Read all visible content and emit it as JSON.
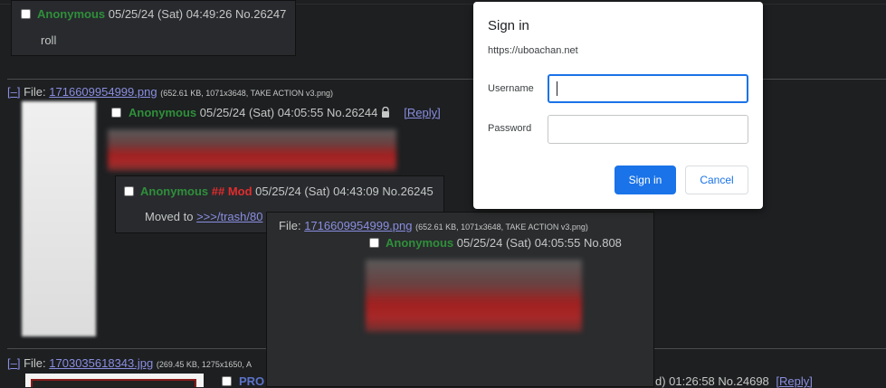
{
  "post_top": {
    "name": "Anonymous",
    "datetime": "05/25/24 (Sat) 04:49:26",
    "number": "No.26247",
    "message": "roll"
  },
  "thread1": {
    "toggle": "[–]",
    "file_label": "File:",
    "file_name": "1716609954999.png",
    "file_info": "(652.61 KB, 1071x3648, TAKE ACTION v3.png)",
    "op_name": "Anonymous",
    "op_datetime": "05/25/24 (Sat) 04:05:55",
    "op_number": "No.26244",
    "lock_icon": "lock-icon",
    "reply_link": "[Reply]",
    "mod_reply": {
      "name": "Anonymous",
      "capcode": "## Mod",
      "datetime": "05/25/24 (Sat) 04:43:09",
      "number": "No.26245",
      "message_prefix": "Moved to ",
      "message_link": ">>>/trash/80"
    }
  },
  "hover_preview": {
    "file_label": "File:",
    "file_name": "1716609954999.png",
    "file_info": "(652.61 KB, 1071x3648, TAKE ACTION v3.png)",
    "name": "Anonymous",
    "datetime": "05/25/24 (Sat) 04:05:55",
    "number": "No.808"
  },
  "thread2": {
    "toggle": "[–]",
    "file_label": "File:",
    "file_name": "1703035618343.jpg",
    "file_info": "(269.45 KB, 1275x1650, A",
    "name_partial": "PRO",
    "datetime_partial": "d) 01:26:58",
    "number": "No.24698",
    "reply_link": "[Reply]"
  },
  "dialog": {
    "title": "Sign in",
    "origin": "https://uboachan.net",
    "username_label": "Username",
    "username_value": "",
    "password_label": "Password",
    "password_value": "",
    "sign_in_button": "Sign in",
    "cancel_button": "Cancel"
  }
}
